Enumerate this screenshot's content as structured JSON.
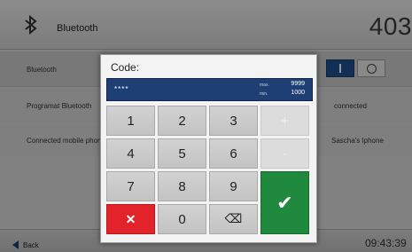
{
  "header": {
    "title": "Bluetooth",
    "number": "403"
  },
  "rows": [
    {
      "label": "Bluetooth",
      "value": ""
    },
    {
      "label": "Programat Bluetooth",
      "value": "connected"
    },
    {
      "label": "Connected mobile phone",
      "value": "Sascha's Iphone"
    }
  ],
  "footer": {
    "back_label": "Back",
    "clock": "09:43:39"
  },
  "dialog": {
    "title": "Code:",
    "value": "****",
    "max_label": "max.",
    "max_value": "9999",
    "min_label": "min.",
    "min_value": "1000"
  },
  "keypad": {
    "keys": [
      "1",
      "2",
      "3",
      "4",
      "5",
      "6",
      "7",
      "8",
      "9",
      "0"
    ],
    "plus": "+",
    "minus": "-",
    "cancel": "✕",
    "ok": "✔",
    "backspace": "⌫"
  },
  "colors": {
    "accent": "#1d3f74",
    "cancel": "#e2232a",
    "ok": "#1f8a3e"
  }
}
